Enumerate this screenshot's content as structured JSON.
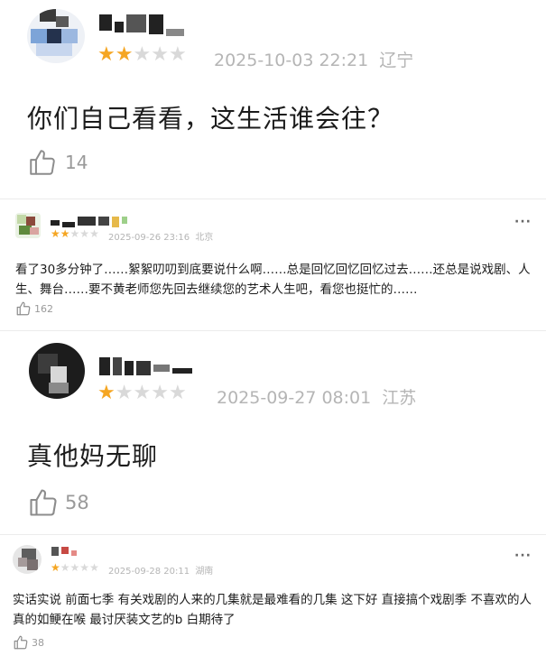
{
  "reviews": [
    {
      "rating": 2,
      "max_rating": 5,
      "date": "2025-10-03 22:21",
      "location": "辽宁",
      "text": "你们自己看看，这生活谁会往？",
      "likes": "14",
      "star_on_color": "#f5a623",
      "star_off_color": "#d9d9d9"
    },
    {
      "rating": 2,
      "max_rating": 5,
      "date": "2025-09-26 23:16",
      "location": "北京",
      "text": "看了30多分钟了……絮絮叨叨到底要说什么啊……总是回忆回忆回忆过去……还总是说戏剧、人生、舞台……要不黄老师您先回去继续您的艺术人生吧，看您也挺忙的……",
      "likes": "162",
      "more_label": "···"
    },
    {
      "rating": 1,
      "max_rating": 5,
      "date": "2025-09-27 08:01",
      "location": "江苏",
      "text": "真他妈无聊",
      "likes": "58"
    },
    {
      "rating": 1,
      "max_rating": 5,
      "date": "2025-09-28 20:11",
      "location": "湖南",
      "text": "实话实说 前面七季 有关戏剧的人来的几集就是最难看的几集 这下好 直接搞个戏剧季 不喜欢的人真的如鲠在喉 最讨厌装文艺的b 白期待了",
      "likes": "38",
      "more_label": "···"
    }
  ]
}
